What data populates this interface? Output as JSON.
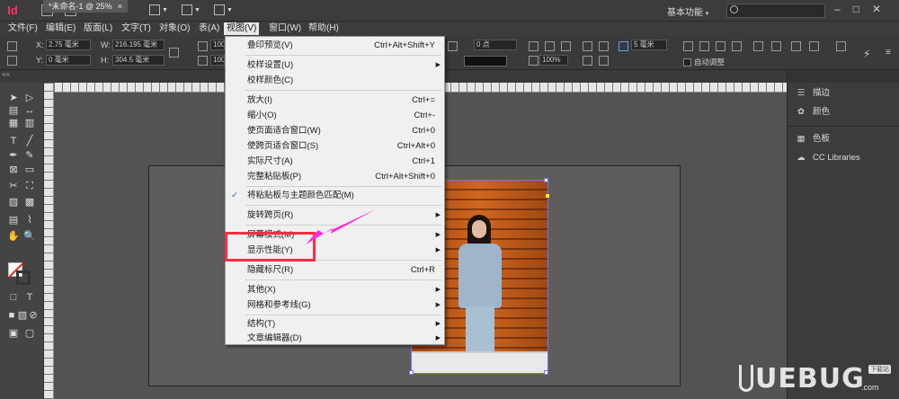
{
  "titlebar": {
    "app_logo": "Id",
    "icon1": "Br",
    "icon2": "St",
    "zoom": "25%",
    "workspace": "基本功能",
    "search_placeholder": ""
  },
  "menubar": [
    {
      "label": "文件(F)"
    },
    {
      "label": "编辑(E)"
    },
    {
      "label": "版面(L)"
    },
    {
      "label": "文字(T)"
    },
    {
      "label": "对象(O)"
    },
    {
      "label": "表(A)"
    },
    {
      "label": "视图(V)"
    },
    {
      "label": "窗口(W)"
    },
    {
      "label": "帮助(H)"
    }
  ],
  "control": {
    "x_label": "X:",
    "x_value": "2.75 毫米",
    "y_label": "Y:",
    "y_value": "0 毫米",
    "w_label": "W:",
    "w_value": "216.195 毫米",
    "h_label": "H:",
    "h_value": "304.5 毫米",
    "scale_x": "100%",
    "scale_y": "100%",
    "stroke_weight": "0 点",
    "opacity": "100%",
    "gap": "5 毫米",
    "auto_fit": "自动调整"
  },
  "doc_tab": {
    "title": "*未命名-1 @ 25%",
    "close": "×"
  },
  "view_menu": {
    "items": [
      {
        "label": "叠印预览(V)",
        "shortcut": "Ctrl+Alt+Shift+Y",
        "submenu": false,
        "checked": false
      },
      {
        "label": "校样设置(U)",
        "shortcut": "",
        "submenu": true,
        "checked": false
      },
      {
        "label": "校样颜色(C)",
        "shortcut": "",
        "submenu": false,
        "checked": false
      },
      {
        "label": "放大(I)",
        "shortcut": "Ctrl+=",
        "submenu": false,
        "checked": false
      },
      {
        "label": "缩小(O)",
        "shortcut": "Ctrl+-",
        "submenu": false,
        "checked": false
      },
      {
        "label": "使页面适合窗口(W)",
        "shortcut": "Ctrl+0",
        "submenu": false,
        "checked": false
      },
      {
        "label": "使跨页适合窗口(S)",
        "shortcut": "Ctrl+Alt+0",
        "submenu": false,
        "checked": false
      },
      {
        "label": "实际尺寸(A)",
        "shortcut": "Ctrl+1",
        "submenu": false,
        "checked": false
      },
      {
        "label": "完整粘贴板(P)",
        "shortcut": "Ctrl+Alt+Shift+0",
        "submenu": false,
        "checked": false
      },
      {
        "label": "将粘贴板与主题颜色匹配(M)",
        "shortcut": "",
        "submenu": false,
        "checked": true
      },
      {
        "label": "旋转跨页(R)",
        "shortcut": "",
        "submenu": true,
        "checked": false
      },
      {
        "label": "屏幕模式(M)",
        "shortcut": "",
        "submenu": true,
        "checked": false
      },
      {
        "label": "显示性能(Y)",
        "shortcut": "",
        "submenu": true,
        "checked": false
      },
      {
        "label": "隐藏标尺(R)",
        "shortcut": "Ctrl+R",
        "submenu": false,
        "checked": false
      },
      {
        "label": "其他(X)",
        "shortcut": "",
        "submenu": true,
        "checked": false
      },
      {
        "label": "网格和参考线(G)",
        "shortcut": "",
        "submenu": true,
        "checked": false
      },
      {
        "label": "结构(T)",
        "shortcut": "",
        "submenu": true,
        "checked": false
      },
      {
        "label": "文章编辑器(D)",
        "shortcut": "",
        "submenu": true,
        "checked": false
      }
    ]
  },
  "right_panel": {
    "items": [
      {
        "label": "描边",
        "icon": "stroke-lines-icon"
      },
      {
        "label": "颜色",
        "icon": "color-palette-icon"
      },
      {
        "label": "色板",
        "icon": "swatches-grid-icon"
      },
      {
        "label": "CC Libraries",
        "icon": "cc-libraries-icon"
      }
    ]
  },
  "watermark": {
    "text": "UEBUG",
    "tag": "下载站",
    "domain": ".com"
  },
  "colors": {
    "menu_bg": "#f0f0f0",
    "highlight_box": "#ff2d43",
    "pointer_arrow": "#ff2dd6",
    "frame_select": "#7c6cf0"
  }
}
